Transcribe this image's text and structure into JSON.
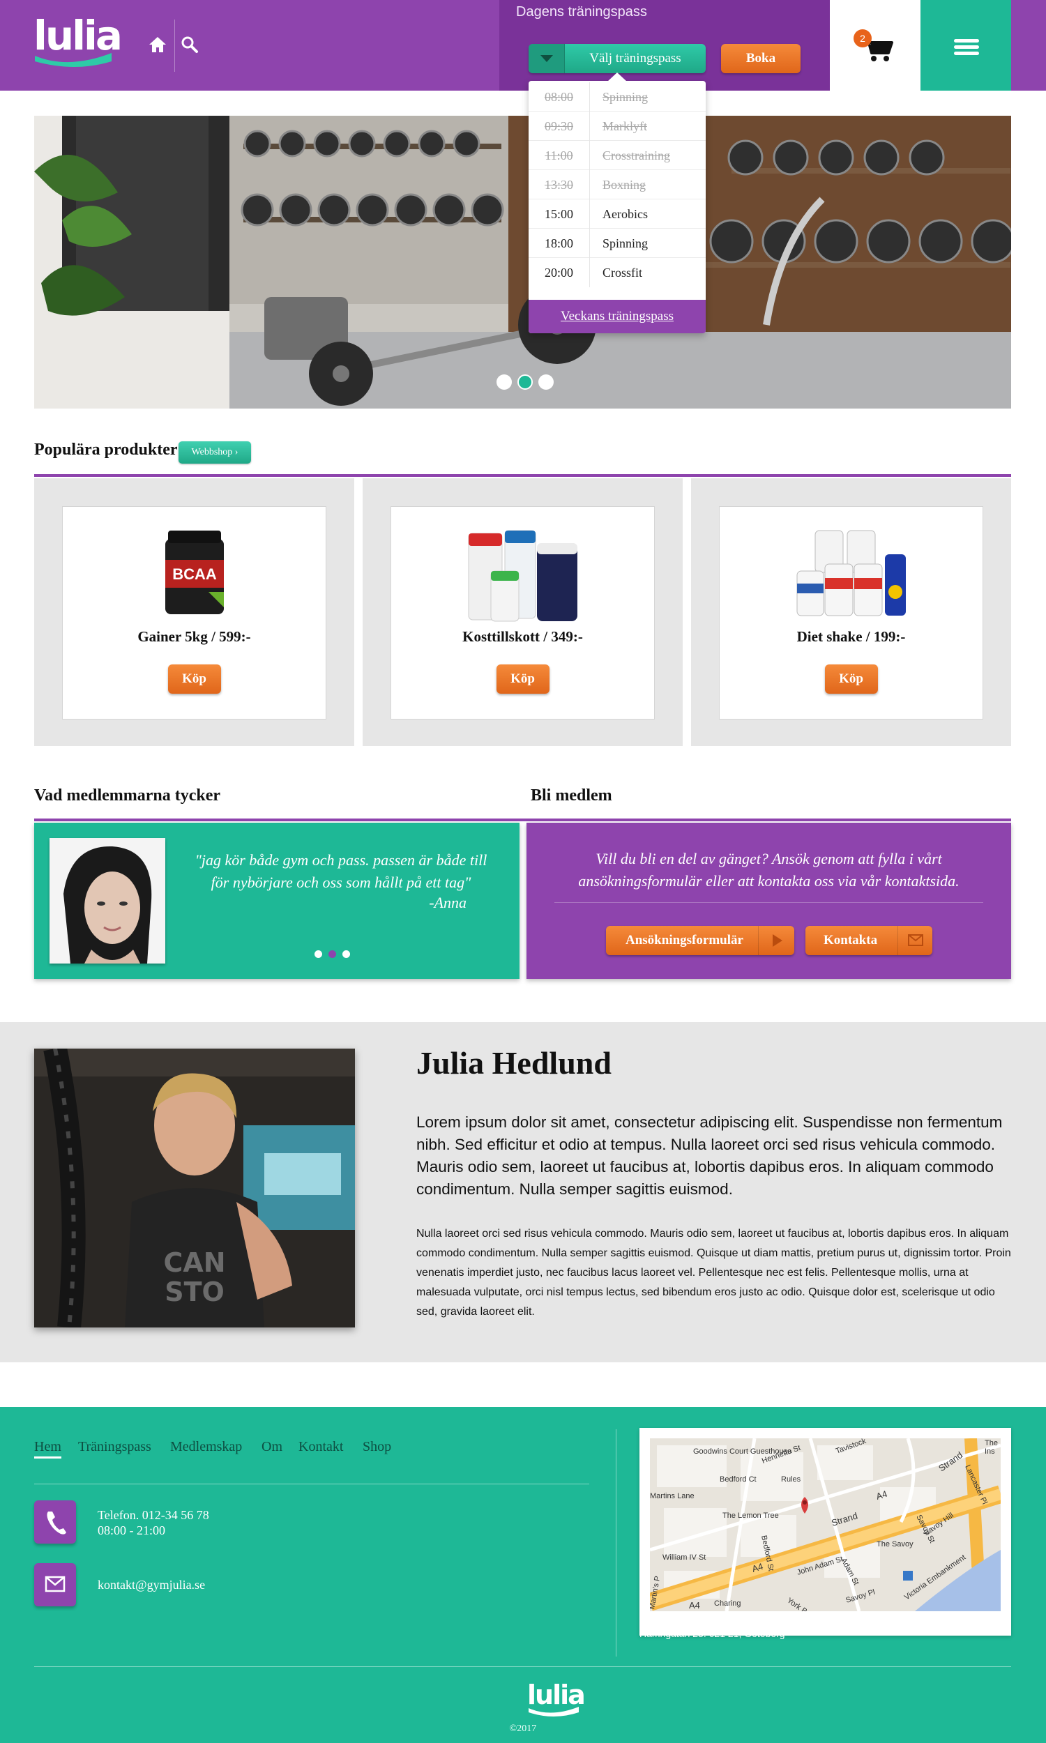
{
  "header": {
    "logo_text": "lulia",
    "training_title": "Dagens träningspass",
    "select_label": "Välj träningspass",
    "book_label": "Boka",
    "cart_count": "2",
    "icons": {
      "home": "home-icon",
      "search": "search-icon",
      "cart": "cart-icon",
      "menu": "hamburger-menu-icon"
    }
  },
  "dropdown": {
    "items": [
      {
        "time": "08:00",
        "name": "Spinning",
        "past": true
      },
      {
        "time": "09:30",
        "name": "Marklyft",
        "past": true
      },
      {
        "time": "11:00",
        "name": "Crosstraining",
        "past": true
      },
      {
        "time": "13:30",
        "name": "Boxning",
        "past": true
      },
      {
        "time": "15:00",
        "name": "Aerobics",
        "past": false
      },
      {
        "time": "18:00",
        "name": "Spinning",
        "past": false
      },
      {
        "time": "20:00",
        "name": "Crossfit",
        "past": false
      }
    ],
    "footer_link": "Veckans träningspass"
  },
  "hero": {
    "slides": 3,
    "active_slide": 2
  },
  "popular": {
    "title": "Populära produkter",
    "shop_button": "Webbshop",
    "products": [
      {
        "name": "Gainer 5kg / 599:-",
        "buy": "Köp"
      },
      {
        "name": "Kosttillskott / 349:-",
        "buy": "Köp"
      },
      {
        "name": "Diet shake / 199:-",
        "buy": "Köp"
      }
    ]
  },
  "testimonial": {
    "title": "Vad medlemmarna tycker",
    "quote": "\"jag kör både gym och pass. passen är både till för nybörjare och oss som hållt på ett tag\"",
    "author": "-Anna",
    "active_dot": 2
  },
  "member": {
    "title": "Bli medlem",
    "text": "Vill du bli en del av gänget? Ansök genom att fylla i vårt ansökningsformulär eller att kontakta oss via vår kontaktsida.",
    "apply_button": "Ansökningsformulär",
    "contact_button": "Kontakta"
  },
  "about": {
    "name": "Julia Hedlund",
    "lead": "Lorem ipsum dolor sit amet, consectetur adipiscing elit. Suspendisse non fermentum nibh. Sed efficitur et odio at tempus. Nulla laoreet orci sed risus vehicula commodo. Mauris odio sem, laoreet ut faucibus at, lobortis dapibus eros. In aliquam commodo condimentum. Nulla semper sagittis euismod.",
    "body": "Nulla laoreet orci sed risus vehicula commodo. Mauris odio sem, laoreet ut faucibus at, lobortis dapibus eros. In aliquam commodo condimentum. Nulla semper sagittis euismod. Quisque ut diam mattis, pretium purus ut, dignissim tortor. Proin venenatis imperdiet justo, nec faucibus lacus laoreet vel. Pellentesque nec est felis. Pellentesque mollis, urna at malesuada vulputate, orci nisl tempus lectus, sed bibendum eros justo ac odio. Quisque dolor est, scelerisque ut odio sed, gravida laoreet elit."
  },
  "footer": {
    "nav": [
      "Hem",
      "Träningspass",
      "Medlemskap",
      "Om",
      "Kontakt",
      "Shop"
    ],
    "phone": "Telefon. 012-34 56 78",
    "hours": "08:00 - 21:00",
    "email": "kontakt@gymjulia.se",
    "address": "Hamngatan 23. 621 21, Göteborg",
    "map_labels": {
      "goodwins": "Goodwins Court Guesthouse",
      "lemon": "The Lemon Tree",
      "savoy": "The Savoy",
      "rules": "Rules",
      "strand": "Strand",
      "strand2": "Strand",
      "a4": "A4",
      "a4b": "A4",
      "a4c": "A4",
      "lancaster": "Lancaster Pl",
      "embankment": "Victoria Embankment",
      "william": "William IV St",
      "bedford": "Bedford St",
      "bedfordct": "Bedford Ct",
      "henrietta": "Henrietta St",
      "tavistock": "Tavistock",
      "adam": "John Adam St",
      "adelphi": "Adam St",
      "savoyst": "Savoy St",
      "savoyhill": "Savoy Hill",
      "savoypl": "Savoy Pl",
      "york": "York Buildi",
      "charing": "Charing",
      "martins": "Martins Lane",
      "martinsp": "Martin's P",
      "ins": "Ins",
      "the": "The"
    },
    "copyright": "©2017",
    "logo_text": "lulia"
  },
  "colors": {
    "purple": "#8e44ad",
    "teal": "#1eb896",
    "orange": "#e8631a"
  }
}
